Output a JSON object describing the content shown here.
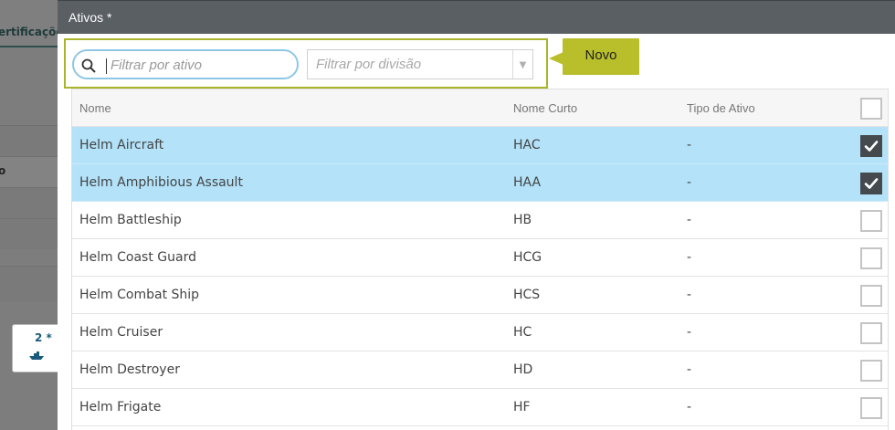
{
  "background": {
    "tab_label": "ertificaçõe",
    "side_label": "o",
    "card_count": "2 *",
    "card_icon": "boat-icon"
  },
  "modal": {
    "title": "Ativos *",
    "search": {
      "placeholder": "Filtrar por ativo",
      "value": ""
    },
    "division": {
      "placeholder": "Filtrar por divisão"
    },
    "callout": "Novo"
  },
  "table": {
    "columns": {
      "name": "Nome",
      "short": "Nome Curto",
      "type": "Tipo de Ativo"
    },
    "rows": [
      {
        "name": "Helm Aircraft",
        "short": "HAC",
        "type": "-",
        "checked": true
      },
      {
        "name": "Helm Amphibious Assault",
        "short": "HAA",
        "type": "-",
        "checked": true
      },
      {
        "name": "Helm Battleship",
        "short": "HB",
        "type": "-",
        "checked": false
      },
      {
        "name": "Helm Coast Guard",
        "short": "HCG",
        "type": "-",
        "checked": false
      },
      {
        "name": "Helm Combat Ship",
        "short": "HCS",
        "type": "-",
        "checked": false
      },
      {
        "name": "Helm Cruiser",
        "short": "HC",
        "type": "-",
        "checked": false
      },
      {
        "name": "Helm Destroyer",
        "short": "HD",
        "type": "-",
        "checked": false
      },
      {
        "name": "Helm Frigate",
        "short": "HF",
        "type": "-",
        "checked": false
      }
    ]
  },
  "colors": {
    "header": "#5a5f63",
    "accent": "#b9bf2a",
    "selected_row": "#b3e2f9",
    "search_border": "#8ec7e6"
  }
}
